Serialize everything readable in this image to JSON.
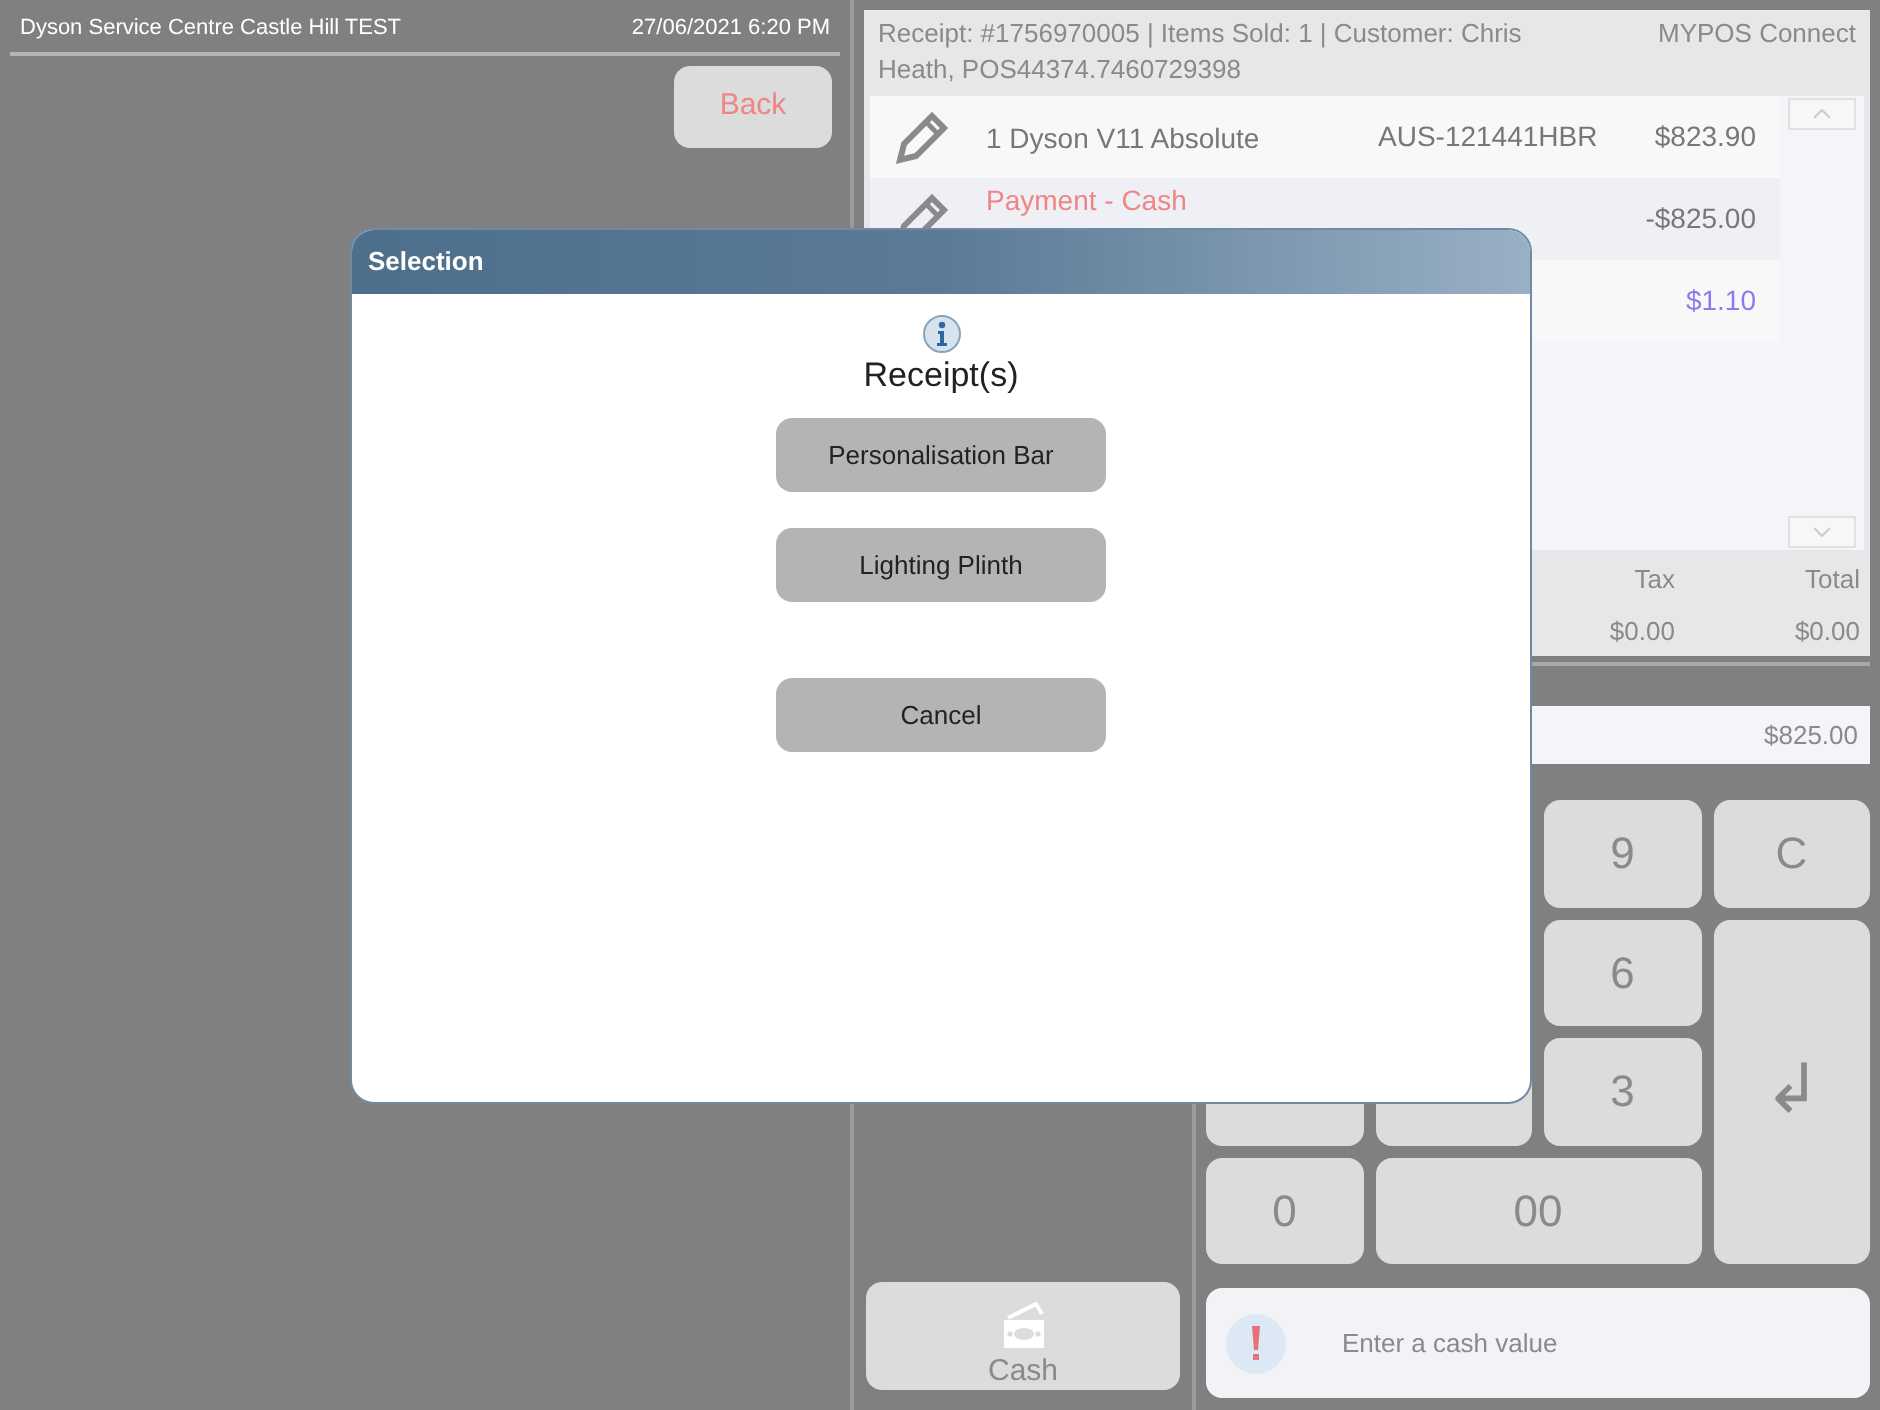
{
  "header": {
    "store": "Dyson Service Centre Castle Hill TEST",
    "datetime": "27/06/2021 6:20 PM"
  },
  "back_button": "Back",
  "receipt": {
    "info": "Receipt: #1756970005 | Items Sold: 1 | Customer: Chris Heath, POS44374.7460729398",
    "source": "MYPOS Connect",
    "lines": [
      {
        "kind": "item",
        "description": "1 Dyson V11 Absolute",
        "code": "AUS-121441HBR",
        "amount": "$823.90",
        "editable": true
      },
      {
        "kind": "payment",
        "description": "Payment - Cash",
        "amount": "-$825.00",
        "editable": true
      },
      {
        "kind": "change",
        "amount": "$1.10"
      }
    ],
    "totals": [
      {
        "label": "Tax",
        "value": "$0.00"
      },
      {
        "label": "Total",
        "value": "$0.00"
      }
    ]
  },
  "amount_field": {
    "value": "$825.00"
  },
  "keypad": [
    {
      "label": "9",
      "kind": "digit"
    },
    {
      "label": "C",
      "kind": "clear"
    },
    {
      "label": "6",
      "kind": "digit"
    },
    {
      "label": "↲",
      "kind": "enter"
    },
    {
      "label": "3",
      "kind": "digit"
    },
    {
      "label": "0",
      "kind": "digit"
    },
    {
      "label": "00",
      "kind": "digit"
    }
  ],
  "cash_button": "Cash",
  "message": {
    "text": "Enter a cash value"
  },
  "dialog": {
    "title": "Selection",
    "heading": "Receipt(s)",
    "options": [
      "Personalisation Bar",
      "Lighting Plinth"
    ],
    "cancel": "Cancel"
  }
}
